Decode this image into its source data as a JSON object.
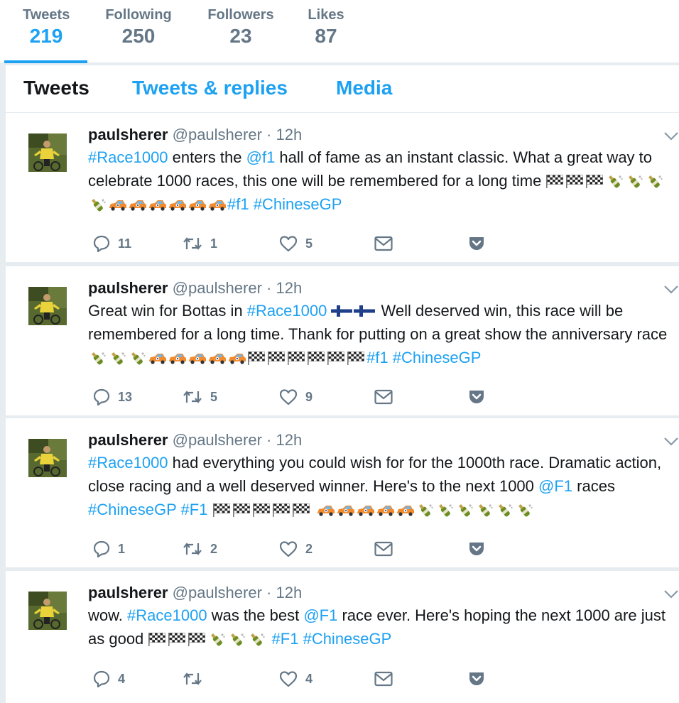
{
  "stats": [
    {
      "label": "Tweets",
      "value": "219"
    },
    {
      "label": "Following",
      "value": "250"
    },
    {
      "label": "Followers",
      "value": "23"
    },
    {
      "label": "Likes",
      "value": "87"
    }
  ],
  "tabs": [
    "Tweets",
    "Tweets & replies",
    "Media"
  ],
  "tweets": [
    {
      "name": "paulsherer",
      "handle": "@paulsherer",
      "time": "· 12h",
      "parts": [
        {
          "l": "#Race1000"
        },
        {
          "t": " enters the "
        },
        {
          "l": "@f1"
        },
        {
          "t": " hall of fame as an instant classic. What a great way to celebrate 1000 races, this one will be remembered for a long time "
        },
        {
          "e": "flag"
        },
        {
          "e": "flag"
        },
        {
          "e": "flag"
        },
        {
          "e": "bottle"
        },
        {
          "e": "bottle"
        },
        {
          "e": "bottle"
        },
        {
          "e": "bottle"
        },
        {
          "e": "car"
        },
        {
          "e": "car"
        },
        {
          "e": "car"
        },
        {
          "e": "car"
        },
        {
          "e": "car"
        },
        {
          "e": "car"
        },
        {
          "l": "#f1"
        },
        {
          "t": " "
        },
        {
          "l": "#ChineseGP"
        }
      ],
      "replies": "11",
      "retweets": "1",
      "likes": "5"
    },
    {
      "name": "paulsherer",
      "handle": "@paulsherer",
      "time": "· 12h",
      "parts": [
        {
          "t": "Great win for Bottas in "
        },
        {
          "l": "#Race1000"
        },
        {
          "t": " "
        },
        {
          "e": "finland"
        },
        {
          "e": "finland"
        },
        {
          "t": "  Well deserved win, this race will be remembered for a long time.  Thank for putting on a great show the anniversary race "
        },
        {
          "e": "bottle"
        },
        {
          "e": "bottle"
        },
        {
          "e": "bottle"
        },
        {
          "e": "car"
        },
        {
          "e": "car"
        },
        {
          "e": "car"
        },
        {
          "e": "car"
        },
        {
          "e": "car"
        },
        {
          "e": "flag"
        },
        {
          "e": "flag"
        },
        {
          "e": "flag"
        },
        {
          "e": "flag"
        },
        {
          "e": "flag"
        },
        {
          "e": "flag"
        },
        {
          "l": "#f1"
        },
        {
          "t": " "
        },
        {
          "l": "#ChineseGP"
        }
      ],
      "replies": "13",
      "retweets": "5",
      "likes": "9"
    },
    {
      "name": "paulsherer",
      "handle": "@paulsherer",
      "time": "· 12h",
      "parts": [
        {
          "l": "#Race1000"
        },
        {
          "t": " had everything you could wish for for the 1000th race.  Dramatic action, close racing and a well deserved winner.  Here's to the next 1000 "
        },
        {
          "l": "@F1"
        },
        {
          "t": " races "
        },
        {
          "l": "#ChineseGP"
        },
        {
          "t": " "
        },
        {
          "l": "#F1"
        },
        {
          "t": " "
        },
        {
          "e": "flag"
        },
        {
          "e": "flag"
        },
        {
          "e": "flag"
        },
        {
          "e": "flag"
        },
        {
          "e": "flag"
        },
        {
          "t": " "
        },
        {
          "e": "car"
        },
        {
          "e": "car"
        },
        {
          "e": "car"
        },
        {
          "e": "car"
        },
        {
          "e": "car"
        },
        {
          "e": "bottle"
        },
        {
          "e": "bottle"
        },
        {
          "e": "bottle"
        },
        {
          "e": "bottle"
        },
        {
          "e": "bottle"
        },
        {
          "e": "bottle"
        }
      ],
      "replies": "1",
      "retweets": "2",
      "likes": "2"
    },
    {
      "name": "paulsherer",
      "handle": "@paulsherer",
      "time": "· 12h",
      "parts": [
        {
          "t": "wow.  "
        },
        {
          "l": "#Race1000"
        },
        {
          "t": " was the best "
        },
        {
          "l": "@F1"
        },
        {
          "t": " race ever.  Here's hoping the next 1000 are just as good "
        },
        {
          "e": "flag"
        },
        {
          "e": "flag"
        },
        {
          "e": "flag"
        },
        {
          "e": "bottle"
        },
        {
          "e": "bottle"
        },
        {
          "e": "bottle"
        },
        {
          "t": " "
        },
        {
          "l": "#F1"
        },
        {
          "t": " "
        },
        {
          "l": "#ChineseGP"
        }
      ],
      "replies": "4",
      "retweets": "",
      "likes": "4"
    }
  ],
  "colors": {
    "accent": "#1da1f2",
    "muted": "#657786",
    "text": "#14171a",
    "divider": "#e6ecf0"
  },
  "icons": {
    "reply": "reply-icon",
    "retweet": "retweet-icon",
    "like": "heart-icon",
    "dm": "envelope-icon",
    "analytics": "pocket-icon",
    "caret": "chevron-down-icon"
  }
}
